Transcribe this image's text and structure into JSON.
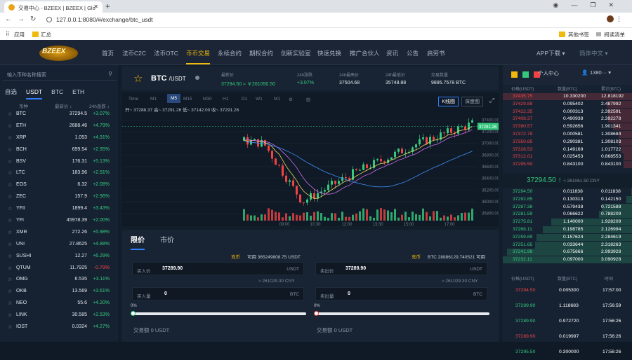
{
  "browser": {
    "tab_title": "交易中心 - BZEEX | BZEEX | Glo",
    "new_tab": "+",
    "url": "127.0.0.1:8080/#/exchange/btc_usdt",
    "bookmarks": [
      {
        "label": "应用"
      },
      {
        "label": "汇总"
      }
    ],
    "bookmarks_right": [
      {
        "label": "其他书签"
      },
      {
        "label": "阅读清单"
      }
    ]
  },
  "header": {
    "logo": "BZEEX",
    "nav": [
      "首页",
      "法币C2C",
      "法币OTC",
      "币币交易",
      "永续合约",
      "期权合约",
      "创新实验室",
      "快速兑换",
      "推广合伙人",
      "资讯",
      "公告",
      "启劳书"
    ],
    "active_nav": "币币交易",
    "app_download": "APP下载 ▾",
    "language": "简体中文 ▾"
  },
  "market": {
    "search_placeholder": "输入币种名称搜索",
    "tabs": [
      "自选",
      "USDT",
      "BTC",
      "ETH"
    ],
    "active_tab": "USDT",
    "columns": [
      "币种",
      "最新价 ↕",
      "24h涨跌 ↕"
    ],
    "rows": [
      {
        "symbol": "BTC",
        "price": "37294.5",
        "change": "+3.07%",
        "dir": "up"
      },
      {
        "symbol": "ETH",
        "price": "2688.46",
        "change": "+4.79%",
        "dir": "up"
      },
      {
        "symbol": "XRP",
        "price": "1.053",
        "change": "+4.91%",
        "dir": "up"
      },
      {
        "symbol": "BCH",
        "price": "699.54",
        "change": "+2.95%",
        "dir": "up"
      },
      {
        "symbol": "BSV",
        "price": "176.31",
        "change": "+5.13%",
        "dir": "up"
      },
      {
        "symbol": "LTC",
        "price": "183.96",
        "change": "+2.91%",
        "dir": "up"
      },
      {
        "symbol": "EOS",
        "price": "6.32",
        "change": "+2.08%",
        "dir": "up"
      },
      {
        "symbol": "ZEC",
        "price": "157.9",
        "change": "+2.96%",
        "dir": "up"
      },
      {
        "symbol": "YFII",
        "price": "1899.4",
        "change": "+3.43%",
        "dir": "up"
      },
      {
        "symbol": "YFI",
        "price": "45978.39",
        "change": "+2.00%",
        "dir": "up"
      },
      {
        "symbol": "XMR",
        "price": "272.26",
        "change": "+5.98%",
        "dir": "up"
      },
      {
        "symbol": "UNI",
        "price": "27.8625",
        "change": "+4.88%",
        "dir": "up"
      },
      {
        "symbol": "SUSHI",
        "price": "12.27",
        "change": "+6.29%",
        "dir": "up"
      },
      {
        "symbol": "QTUM",
        "price": "11.7925",
        "change": "-0.79%",
        "dir": "dn"
      },
      {
        "symbol": "OMG",
        "price": "6.535",
        "change": "+3.11%",
        "dir": "up"
      },
      {
        "symbol": "OKB",
        "price": "13.569",
        "change": "+3.61%",
        "dir": "up"
      },
      {
        "symbol": "NEO",
        "price": "55.6",
        "change": "+4.20%",
        "dir": "up"
      },
      {
        "symbol": "LINK",
        "price": "30.585",
        "change": "+2.53%",
        "dir": "up"
      },
      {
        "symbol": "IOST",
        "price": "0.0324",
        "change": "+4.27%",
        "dir": "up"
      }
    ]
  },
  "ticker": {
    "pair": "BTC",
    "quote": "/USDT",
    "stats": [
      {
        "label": "最新价",
        "value": "37294.50 ≈ ￥261050.50",
        "color": "#36c97e"
      },
      {
        "label": "24h涨跌",
        "value": "+3.07%",
        "color": "#36c97e"
      },
      {
        "label": "24h最高价",
        "value": "37504.68",
        "color": "#e3e8ee"
      },
      {
        "label": "24h最低价",
        "value": "35748.88",
        "color": "#e3e8ee"
      },
      {
        "label": "交易数量",
        "value": "9895.7578 BTC",
        "color": "#e3e8ee"
      }
    ]
  },
  "chart_toolbar": {
    "intervals": [
      "Time",
      "M1",
      "M5",
      "M15",
      "M30",
      "H1",
      "D1",
      "W1",
      "M1"
    ],
    "active": "M5",
    "kline": "K线图",
    "depth": "深度图",
    "ma_line": "开~ 37288.37  高~ 37291.26  低~ 37142.00  收~ 37291.26"
  },
  "chart_data": {
    "type": "candlestick",
    "price_ticks": [
      "37400.00",
      "37200.00",
      "37000.00",
      "36800.00",
      "36600.00",
      "36400.00",
      "36200.00",
      "36000.00",
      "35800.00"
    ],
    "time_ticks": [
      "09:00",
      "10:30",
      "12:00",
      "13:30",
      "15:00",
      "17:00"
    ],
    "last_price_label": "37291.26",
    "ylim": [
      35700,
      37500
    ],
    "colors": {
      "up": "#36c97e",
      "down": "#f04444"
    }
  },
  "order_form": {
    "tabs": [
      "限价",
      "市价"
    ],
    "active": "限价",
    "buy": {
      "coin_label": "充币",
      "available": "可用 365249808.75 USDT",
      "price_label": "买入价",
      "price": "37289.90",
      "price_unit": "USDT",
      "cny": "≈ 261029.30 CNY",
      "qty_label": "买入量",
      "qty": "0",
      "qty_unit": "BTC",
      "pct": "0%",
      "total": "交易额 0 USDT"
    },
    "sell": {
      "coin_label": "充币",
      "available": "BTC 28886129.740521 可用",
      "price_label": "卖出价",
      "price": "37289.90",
      "price_unit": "USDT",
      "cny": "≈ 261029.30 CNY",
      "qty_label": "卖出量",
      "qty": "0",
      "qty_unit": "BTC",
      "pct": "0%",
      "total": "交易额 0 USDT"
    }
  },
  "orderbook": {
    "title": "个人中心",
    "user": "1380··· ▾",
    "columns": [
      "价格(USDT)",
      "数量(BTC)",
      "累计(BTC)"
    ],
    "asks": [
      [
        "37435.75",
        "10.330200",
        "12.818192"
      ],
      [
        "37429.89",
        "0.095402",
        "2.487992"
      ],
      [
        "37422.35",
        "0.000313",
        "2.392591"
      ],
      [
        "37408.37",
        "0.490938",
        "2.392278"
      ],
      [
        "37390.57",
        "0.592656",
        "1.901341"
      ],
      [
        "37372.78",
        "0.000581",
        "1.308684"
      ],
      [
        "37350.85",
        "0.290381",
        "1.308103"
      ],
      [
        "37328.53",
        "0.149169",
        "1.017722"
      ],
      [
        "37312.01",
        "0.025453",
        "0.868553"
      ],
      [
        "37295.50",
        "0.843100",
        "0.843100"
      ]
    ],
    "mid_price": "37294.50 ↑",
    "mid_cny": "≈ 261061.50 CNY",
    "bids": [
      [
        "37294.50",
        "0.011838",
        "0.011838"
      ],
      [
        "37292.85",
        "0.130313",
        "0.142150"
      ],
      [
        "37287.38",
        "0.579438",
        "0.721588"
      ],
      [
        "37281.59",
        "0.066622",
        "0.788209"
      ],
      [
        "37275.81",
        "1.140000",
        "1.928209"
      ],
      [
        "37268.11",
        "0.198785",
        "2.126994"
      ],
      [
        "37259.89",
        "0.157624",
        "2.284619"
      ],
      [
        "37251.65",
        "0.033644",
        "2.318263"
      ],
      [
        "37241.98",
        "0.675666",
        "2.993928"
      ],
      [
        "37232.11",
        "0.097000",
        "3.090928"
      ]
    ]
  },
  "trades": {
    "columns": [
      "价格(USDT)",
      "数量(BTC)",
      "时间"
    ],
    "rows": [
      {
        "price": "37294.50",
        "qty": "0.005300",
        "time": "17:57:00",
        "dir": "dn"
      },
      {
        "price": "37289.90",
        "qty": "1.118683",
        "time": "17:56:59",
        "dir": "up"
      },
      {
        "price": "37289.90",
        "qty": "0.972720",
        "time": "17:56:26",
        "dir": "up"
      },
      {
        "price": "37289.90",
        "qty": "0.019997",
        "time": "17:56:26",
        "dir": "dn"
      },
      {
        "price": "37295.50",
        "qty": "0.300000",
        "time": "17:56:26",
        "dir": "up"
      }
    ]
  }
}
